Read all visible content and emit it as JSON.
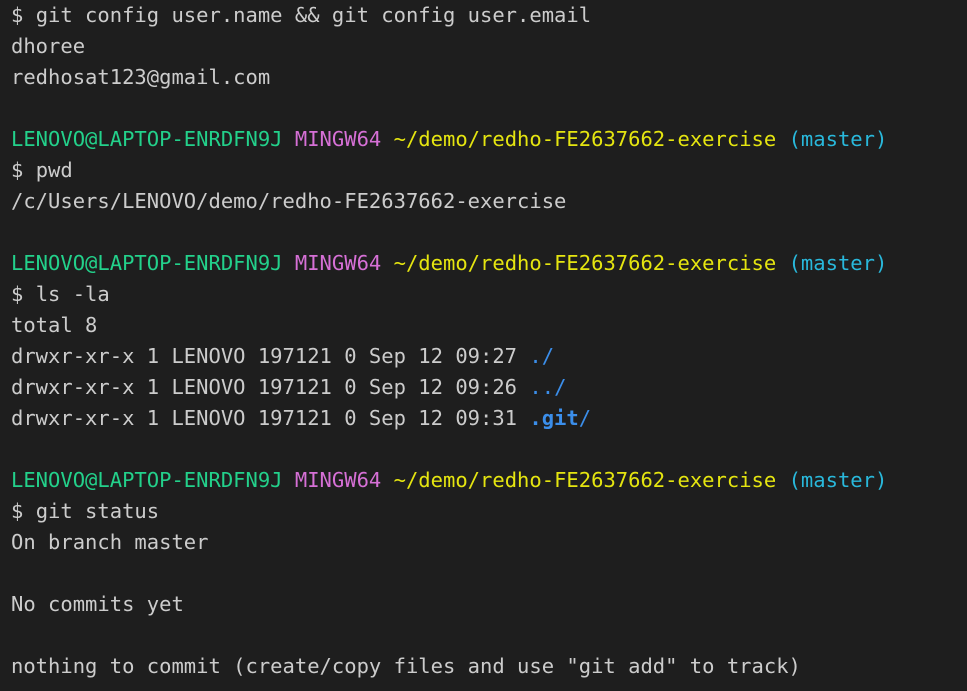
{
  "colors": {
    "background": "#1e1e1e",
    "text": "#cccccc",
    "user_host": "#23d18b",
    "msystem": "#d670d6",
    "cwd": "#e5e510",
    "branch": "#29b8db",
    "directory": "#3b8eea"
  },
  "prompt": {
    "user_host": "LENOVO@LAPTOP-ENRDFN9J",
    "msystem": "MINGW64",
    "cwd": "~/demo/redho-FE2637662-exercise",
    "branch": "(master)",
    "symbol": "$"
  },
  "block1": {
    "command": "git config user.name && git config user.email",
    "output_name": "dhoree",
    "output_email": "redhosat123@gmail.com"
  },
  "block2": {
    "command": "pwd",
    "output": "/c/Users/LENOVO/demo/redho-FE2637662-exercise"
  },
  "block3": {
    "command": "ls -la",
    "total": "total 8",
    "entries": [
      {
        "meta": "drwxr-xr-x 1 LENOVO 197121 0 Sep 12 09:27 ",
        "name": "./",
        "name_main": ".",
        "suffix": "/"
      },
      {
        "meta": "drwxr-xr-x 1 LENOVO 197121 0 Sep 12 09:26 ",
        "name": "../",
        "name_main": "..",
        "suffix": "/"
      },
      {
        "meta": "drwxr-xr-x 1 LENOVO 197121 0 Sep 12 09:31 ",
        "name": ".git/",
        "name_main": ".git",
        "suffix": "/"
      }
    ]
  },
  "block4": {
    "command": "git status",
    "line1": "On branch master",
    "line2": "No commits yet",
    "line3": "nothing to commit (create/copy files and use \"git add\" to track)"
  }
}
